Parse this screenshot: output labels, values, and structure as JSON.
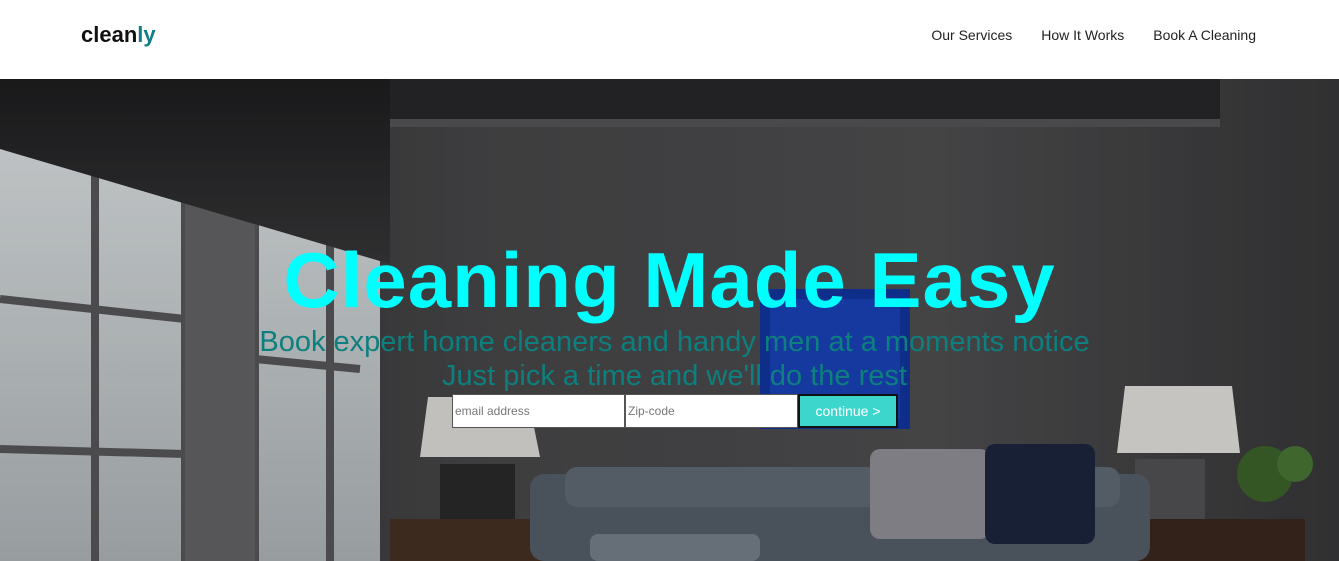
{
  "brand": {
    "name_main": "clean",
    "name_accent": "ly",
    "accent_color": "#0e7f86"
  },
  "nav": {
    "items": [
      {
        "label": "Our Services"
      },
      {
        "label": "How It Works"
      },
      {
        "label": "Book A Cleaning"
      }
    ]
  },
  "hero": {
    "headline": "Cleaning Made Easy",
    "headline_color": "#00ffff",
    "subtitle_line1": "Book expert home cleaners and handy men at a moments notice",
    "subtitle_line2": "Just pick a time and we'll do the rest",
    "subtitle_color": "#0d7f7e"
  },
  "signup_form": {
    "email_placeholder": "email address",
    "zip_placeholder": "Zip-code",
    "submit_label": "continue >",
    "submit_color": "#3dd6cc"
  }
}
